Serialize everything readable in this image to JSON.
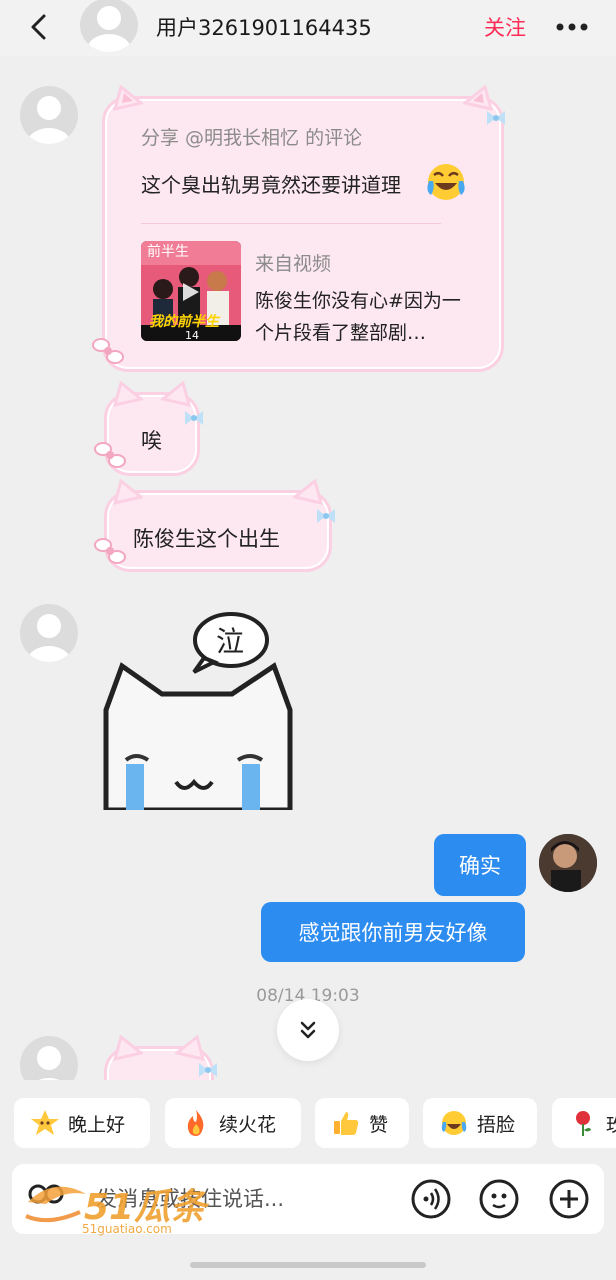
{
  "header": {
    "username": "用户3261901164435",
    "follow_label": "关注"
  },
  "messages": {
    "share": {
      "label": "分享 @明我长相忆 的评论",
      "text": "这个臭出轨男竟然还要讲道理",
      "video_label": "来自视频",
      "video_text": "陈俊生你没有心#因为一个片段看了整部剧…",
      "thumb_title": "我的前半生",
      "thumb_title_top": "前半生",
      "thumb_num": "14"
    },
    "short1": "唉",
    "short2": "陈俊生这个出生",
    "sticker_text": "泣",
    "mine1": "确实",
    "mine2": "感觉跟你前男友好像",
    "timestamp": "08/14 19:03"
  },
  "quick_replies": [
    {
      "label": "晚上好",
      "icon": "star-face-icon"
    },
    {
      "label": "续火花",
      "icon": "fire-icon"
    },
    {
      "label": "赞",
      "icon": "thumbs-up-icon"
    },
    {
      "label": "捂脸",
      "icon": "facepalm-icon"
    },
    {
      "label": "玫",
      "icon": "rose-icon"
    }
  ],
  "input": {
    "placeholder": "发消息或按住说话..."
  },
  "watermark": {
    "text": "51瓜条",
    "url": "51guatiao.com"
  },
  "colors": {
    "accent_red": "#fe2c55",
    "bubble_blue": "#2d8cf0",
    "bubble_pink": "#fde8f1"
  }
}
